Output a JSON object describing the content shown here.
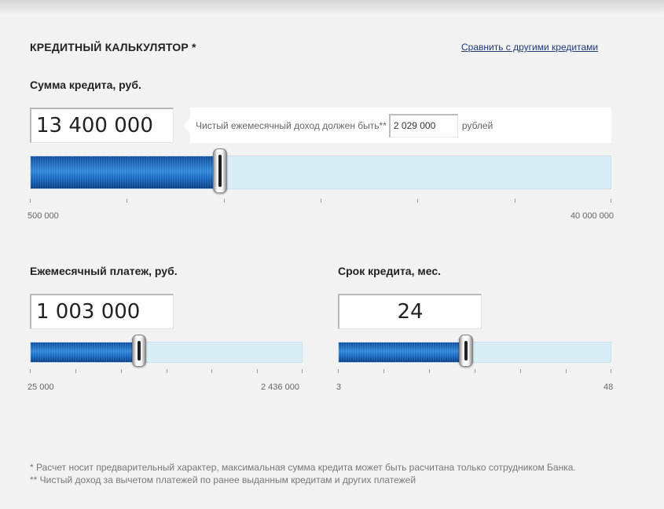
{
  "header": {
    "title": "КРЕДИТНЫЙ КАЛЬКУЛЯТОР *",
    "compare_link": "Сравнить с другими кредитами"
  },
  "loan_amount": {
    "label": "Сумма кредита, руб.",
    "value": "13 400 000",
    "min_label": "500 000",
    "max_label": "40 000 000",
    "slider_fraction": 0.327
  },
  "income_hint": {
    "text": "Чистый ежемесячный доход должен быть**",
    "value": "2 029 000",
    "unit": "рублей"
  },
  "monthly_payment": {
    "label": "Ежемесячный платеж, руб.",
    "value": "1 003 000",
    "min_label": "25 000",
    "max_label": "2 436 000",
    "slider_fraction": 0.4
  },
  "loan_term": {
    "label": "Срок кредита, мес.",
    "value": "24",
    "min_label": "3",
    "max_label": "48",
    "slider_fraction": 0.467
  },
  "footnotes": {
    "note1": "* Расчет носит предварительный характер, максимальная сумма кредита может быть расчитана только сотрудником Банка.",
    "note2": "** Чистый доход за вычетом платежей по ранее выданным кредитам и других платежей"
  },
  "colors": {
    "background": "#f2f2f2",
    "slider_fill": "#1a6ac4",
    "slider_track": "#d9edf6",
    "link": "#1f3a78"
  }
}
